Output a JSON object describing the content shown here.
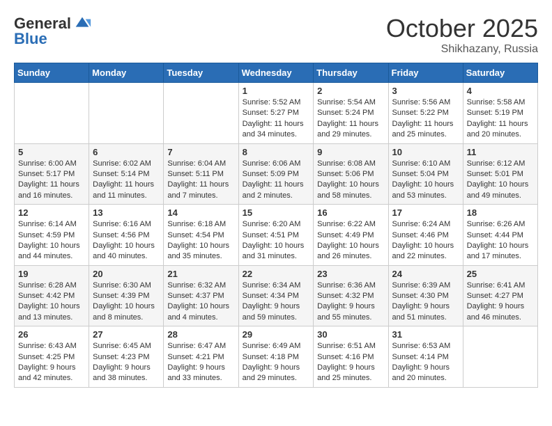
{
  "header": {
    "logo_general": "General",
    "logo_blue": "Blue",
    "month": "October 2025",
    "location": "Shikhazany, Russia"
  },
  "days_of_week": [
    "Sunday",
    "Monday",
    "Tuesday",
    "Wednesday",
    "Thursday",
    "Friday",
    "Saturday"
  ],
  "weeks": [
    [
      {
        "day": "",
        "info": ""
      },
      {
        "day": "",
        "info": ""
      },
      {
        "day": "",
        "info": ""
      },
      {
        "day": "1",
        "info": "Sunrise: 5:52 AM\nSunset: 5:27 PM\nDaylight: 11 hours and 34 minutes."
      },
      {
        "day": "2",
        "info": "Sunrise: 5:54 AM\nSunset: 5:24 PM\nDaylight: 11 hours and 29 minutes."
      },
      {
        "day": "3",
        "info": "Sunrise: 5:56 AM\nSunset: 5:22 PM\nDaylight: 11 hours and 25 minutes."
      },
      {
        "day": "4",
        "info": "Sunrise: 5:58 AM\nSunset: 5:19 PM\nDaylight: 11 hours and 20 minutes."
      }
    ],
    [
      {
        "day": "5",
        "info": "Sunrise: 6:00 AM\nSunset: 5:17 PM\nDaylight: 11 hours and 16 minutes."
      },
      {
        "day": "6",
        "info": "Sunrise: 6:02 AM\nSunset: 5:14 PM\nDaylight: 11 hours and 11 minutes."
      },
      {
        "day": "7",
        "info": "Sunrise: 6:04 AM\nSunset: 5:11 PM\nDaylight: 11 hours and 7 minutes."
      },
      {
        "day": "8",
        "info": "Sunrise: 6:06 AM\nSunset: 5:09 PM\nDaylight: 11 hours and 2 minutes."
      },
      {
        "day": "9",
        "info": "Sunrise: 6:08 AM\nSunset: 5:06 PM\nDaylight: 10 hours and 58 minutes."
      },
      {
        "day": "10",
        "info": "Sunrise: 6:10 AM\nSunset: 5:04 PM\nDaylight: 10 hours and 53 minutes."
      },
      {
        "day": "11",
        "info": "Sunrise: 6:12 AM\nSunset: 5:01 PM\nDaylight: 10 hours and 49 minutes."
      }
    ],
    [
      {
        "day": "12",
        "info": "Sunrise: 6:14 AM\nSunset: 4:59 PM\nDaylight: 10 hours and 44 minutes."
      },
      {
        "day": "13",
        "info": "Sunrise: 6:16 AM\nSunset: 4:56 PM\nDaylight: 10 hours and 40 minutes."
      },
      {
        "day": "14",
        "info": "Sunrise: 6:18 AM\nSunset: 4:54 PM\nDaylight: 10 hours and 35 minutes."
      },
      {
        "day": "15",
        "info": "Sunrise: 6:20 AM\nSunset: 4:51 PM\nDaylight: 10 hours and 31 minutes."
      },
      {
        "day": "16",
        "info": "Sunrise: 6:22 AM\nSunset: 4:49 PM\nDaylight: 10 hours and 26 minutes."
      },
      {
        "day": "17",
        "info": "Sunrise: 6:24 AM\nSunset: 4:46 PM\nDaylight: 10 hours and 22 minutes."
      },
      {
        "day": "18",
        "info": "Sunrise: 6:26 AM\nSunset: 4:44 PM\nDaylight: 10 hours and 17 minutes."
      }
    ],
    [
      {
        "day": "19",
        "info": "Sunrise: 6:28 AM\nSunset: 4:42 PM\nDaylight: 10 hours and 13 minutes."
      },
      {
        "day": "20",
        "info": "Sunrise: 6:30 AM\nSunset: 4:39 PM\nDaylight: 10 hours and 8 minutes."
      },
      {
        "day": "21",
        "info": "Sunrise: 6:32 AM\nSunset: 4:37 PM\nDaylight: 10 hours and 4 minutes."
      },
      {
        "day": "22",
        "info": "Sunrise: 6:34 AM\nSunset: 4:34 PM\nDaylight: 9 hours and 59 minutes."
      },
      {
        "day": "23",
        "info": "Sunrise: 6:36 AM\nSunset: 4:32 PM\nDaylight: 9 hours and 55 minutes."
      },
      {
        "day": "24",
        "info": "Sunrise: 6:39 AM\nSunset: 4:30 PM\nDaylight: 9 hours and 51 minutes."
      },
      {
        "day": "25",
        "info": "Sunrise: 6:41 AM\nSunset: 4:27 PM\nDaylight: 9 hours and 46 minutes."
      }
    ],
    [
      {
        "day": "26",
        "info": "Sunrise: 6:43 AM\nSunset: 4:25 PM\nDaylight: 9 hours and 42 minutes."
      },
      {
        "day": "27",
        "info": "Sunrise: 6:45 AM\nSunset: 4:23 PM\nDaylight: 9 hours and 38 minutes."
      },
      {
        "day": "28",
        "info": "Sunrise: 6:47 AM\nSunset: 4:21 PM\nDaylight: 9 hours and 33 minutes."
      },
      {
        "day": "29",
        "info": "Sunrise: 6:49 AM\nSunset: 4:18 PM\nDaylight: 9 hours and 29 minutes."
      },
      {
        "day": "30",
        "info": "Sunrise: 6:51 AM\nSunset: 4:16 PM\nDaylight: 9 hours and 25 minutes."
      },
      {
        "day": "31",
        "info": "Sunrise: 6:53 AM\nSunset: 4:14 PM\nDaylight: 9 hours and 20 minutes."
      },
      {
        "day": "",
        "info": ""
      }
    ]
  ]
}
